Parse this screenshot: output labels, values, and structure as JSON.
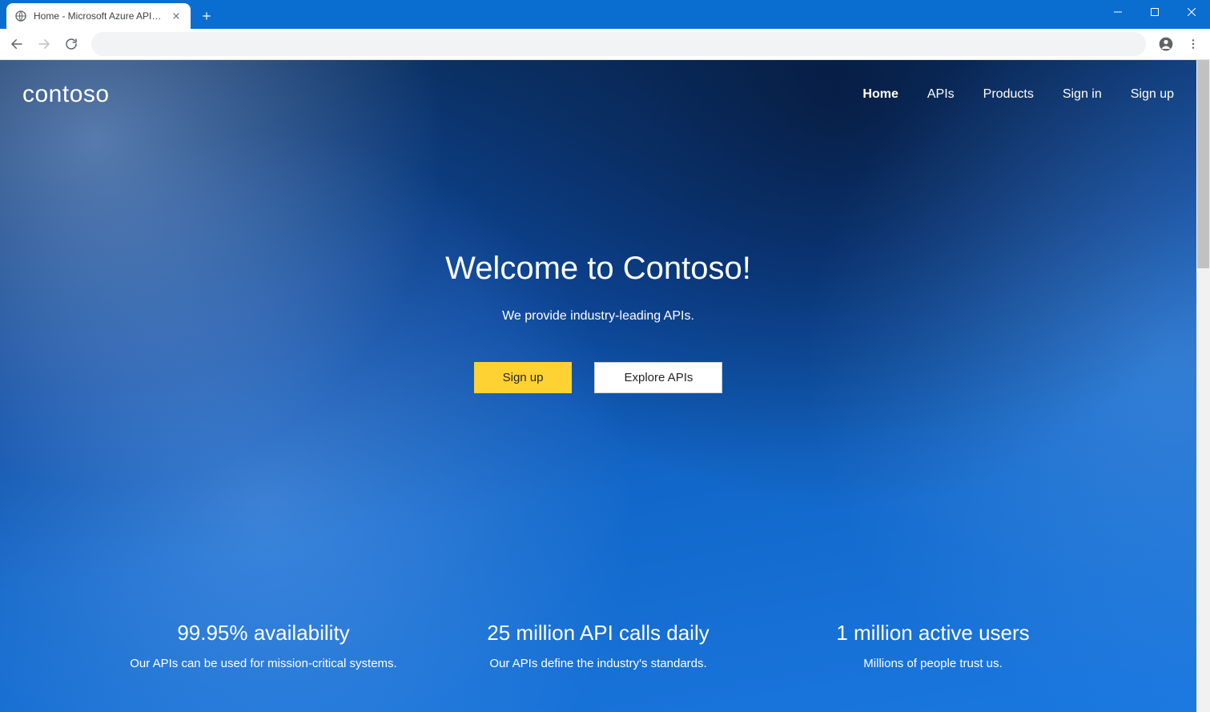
{
  "browser": {
    "tab_title": "Home - Microsoft Azure API Man"
  },
  "header": {
    "brand": "contoso",
    "nav": [
      {
        "label": "Home",
        "active": true
      },
      {
        "label": "APIs",
        "active": false
      },
      {
        "label": "Products",
        "active": false
      },
      {
        "label": "Sign in",
        "active": false
      },
      {
        "label": "Sign up",
        "active": false
      }
    ]
  },
  "hero": {
    "title": "Welcome to Contoso!",
    "subtitle": "We provide industry-leading APIs.",
    "cta_primary": "Sign up",
    "cta_secondary": "Explore APIs"
  },
  "features": [
    {
      "title": "99.95% availability",
      "subtitle": "Our APIs can be used for mission-critical systems."
    },
    {
      "title": "25 million API calls daily",
      "subtitle": "Our APIs define the industry's standards."
    },
    {
      "title": "1 million active users",
      "subtitle": "Millions of people trust us."
    }
  ]
}
